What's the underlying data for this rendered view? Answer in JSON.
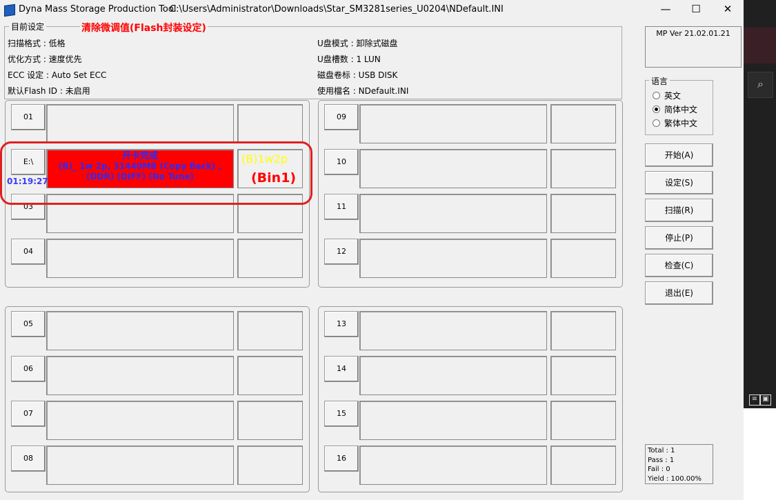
{
  "window": {
    "title": "Dyna Mass Storage Production Tool",
    "path": "C:\\Users\\Administrator\\Downloads\\Star_SM3281series_U0204\\NDefault.INI",
    "min_glyph": "—",
    "max_glyph": "☐",
    "close_glyph": "✕"
  },
  "annotation": "清除微调值(Flash封装设定)",
  "current_settings": {
    "legend": "目前设定",
    "left": [
      "扫描格式 : 低格",
      "优化方式 : 速度优先",
      "ECC 设定 : Auto Set ECC",
      "默认Flash ID : 未启用"
    ],
    "right": [
      "U盘模式 : 卸除式磁盘",
      "U盘槽数 : 1 LUN",
      "磁盘卷标 : USB DISK",
      "使用檔名 : NDefault.INI"
    ]
  },
  "version": "MP Ver 21.02.01.21",
  "language": {
    "legend": "语言",
    "options": [
      "英文",
      "简体中文",
      "繁体中文"
    ],
    "selected": "简体中文"
  },
  "buttons": [
    "开始(A)",
    "设定(S)",
    "扫描(R)",
    "停止(P)",
    "检查(C)",
    "退出(E)"
  ],
  "ports": {
    "p01": "01",
    "pE": "E:\\",
    "p03": "03",
    "p04": "04",
    "p05": "05",
    "p06": "06",
    "p07": "07",
    "p08": "08",
    "p09": "09",
    "p10": "10",
    "p11": "11",
    "p12": "12",
    "p13": "13",
    "p14": "14",
    "p15": "15",
    "p16": "16"
  },
  "active_slot": {
    "status": "开卡完成",
    "line2": "(B)_ 1w 2p, 31440MB  (Copy Back) ,",
    "line3": "(DDR) (DIFF) (No Tune)",
    "timer": "01:19:27",
    "bin_code": "(B)1w2p",
    "bin": "(Bin1)"
  },
  "stats": {
    "total": "Total : 1",
    "pass": "Pass : 1",
    "fail": "Fail    : 0",
    "yield": "Yield : 100.00%"
  },
  "colors": {
    "fail_fill": "#ff0000",
    "highlight": "#e02020",
    "text_blue": "#2a2aff",
    "bin_yellow": "#ffff00"
  },
  "icons": [
    "app-icon",
    "search-icon",
    "list-view-icon",
    "tile-view-icon"
  ]
}
